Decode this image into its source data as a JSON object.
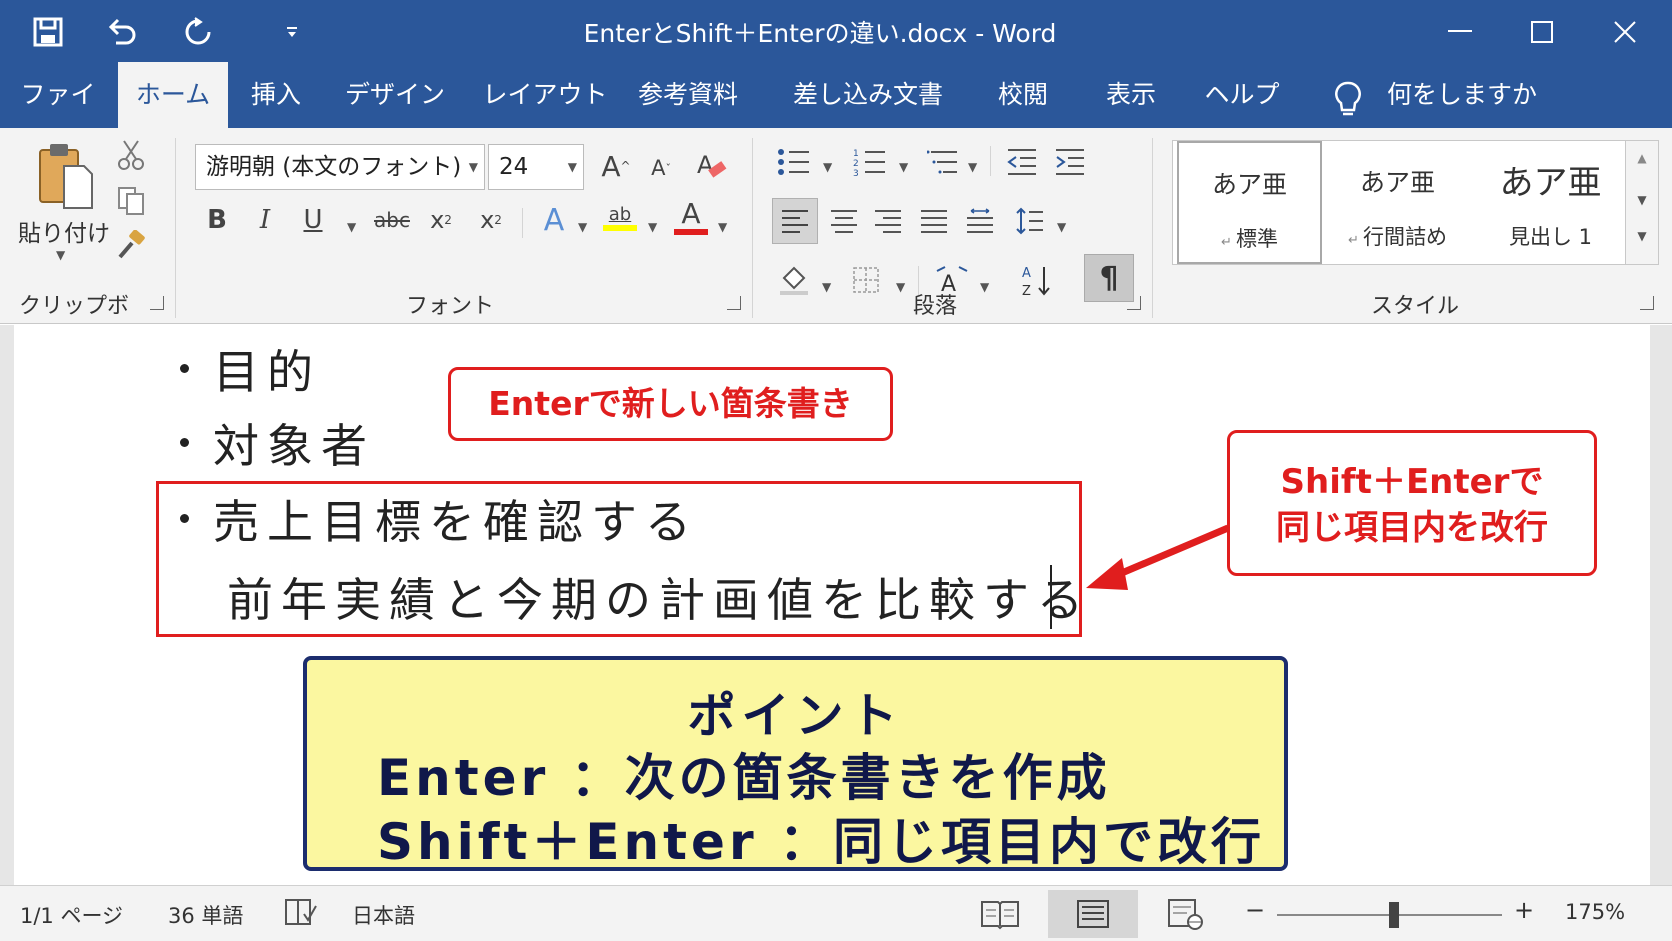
{
  "title_bar": {
    "document_title": "EnterとShift＋Enterの違い.docx  -  Word",
    "qat": [
      "save-icon",
      "undo-icon",
      "redo-icon",
      "customize-qat-icon"
    ],
    "window_controls": [
      "minimize-icon",
      "maximize-icon",
      "close-icon"
    ]
  },
  "tabs": [
    {
      "label": "ファイル"
    },
    {
      "label": "ホーム",
      "active": true
    },
    {
      "label": "挿入"
    },
    {
      "label": "デザイン"
    },
    {
      "label": "レイアウト"
    },
    {
      "label": "参考資料"
    },
    {
      "label": "差し込み文書"
    },
    {
      "label": "校閲"
    },
    {
      "label": "表示"
    },
    {
      "label": "ヘルプ"
    }
  ],
  "tell_me": "何をしますか",
  "ribbon": {
    "clipboard": {
      "label": "クリップボード",
      "paste_label": "貼り付け"
    },
    "font": {
      "label": "フォント",
      "font_name": "游明朝 (本文のフォント)",
      "font_size": "24",
      "grow": "A",
      "shrink": "A",
      "bold": "B",
      "italic": "I",
      "underline": "U",
      "strike": "abc",
      "subscript": "x",
      "superscript": "x",
      "effects": "A",
      "highlight": "ab",
      "font_color": "A",
      "highlight_color": "#ffff00",
      "font_color_value": "#e01e1e"
    },
    "paragraph": {
      "label": "段落",
      "show_marks": "¶"
    },
    "styles": {
      "label": "スタイル",
      "items": [
        {
          "sample": "あア亜",
          "name": "標準",
          "selected": true
        },
        {
          "sample": "あア亜",
          "name": "行間詰め"
        },
        {
          "sample": "あア亜",
          "name": "見出し 1"
        }
      ]
    }
  },
  "document": {
    "bullets": [
      "目的",
      "対象者",
      "売上目標を確認する"
    ],
    "continuation": "前年実績と今期の計画値を比較する",
    "callout_enter": "Enterで新しい箇条書き",
    "callout_shift_line1": "Shift＋Enterで",
    "callout_shift_line2": "同じ項目内を改行",
    "point_title": "ポイント",
    "point_line1": "Enter ：次の箇条書きを作成",
    "point_line2": "Shift＋Enter ：同じ項目内で改行",
    "accent_red": "#e01e1e",
    "point_bg": "#fbf7a0",
    "point_border": "#1c2d6e"
  },
  "status_bar": {
    "page": "1/1 ページ",
    "words": "36 単語",
    "language": "日本語",
    "zoom_minus": "−",
    "zoom_plus": "+",
    "zoom": "175%",
    "zoom_fraction": 0.52
  },
  "colors": {
    "word_blue": "#2b579a",
    "ribbon_bg": "#f3f3f3"
  }
}
